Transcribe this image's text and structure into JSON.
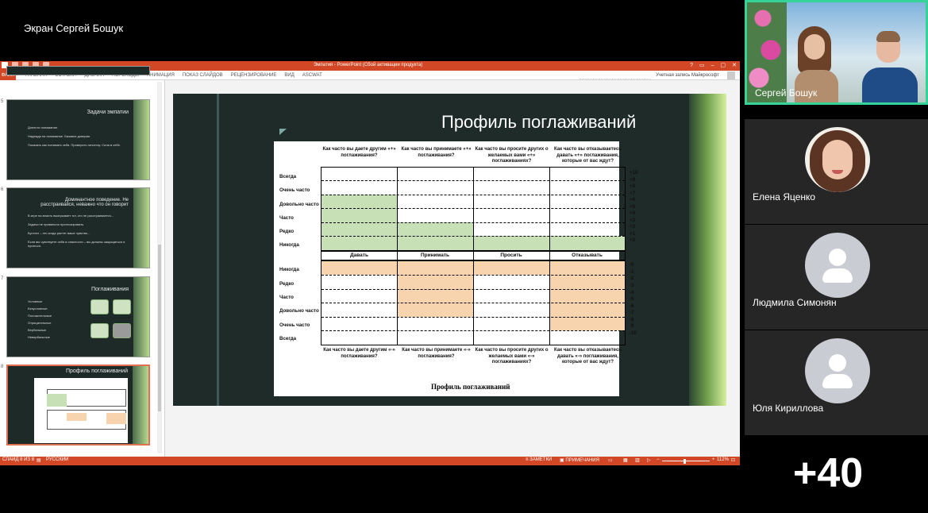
{
  "share_label": "Экран Сергей Бошук",
  "ppt": {
    "title": "Эмпатия - PowerPoint (Сбой активации продукта)",
    "file_tab": "ФАЙЛ",
    "tabs": [
      "ГЛАВНАЯ",
      "ВСТАВКА",
      "ДИЗАЙН",
      "ПЕРЕХОДЫ",
      "АНИМАЦИЯ",
      "ПОКАЗ СЛАЙДОВ",
      "РЕЦЕНЗИРОВАНИЕ",
      "ВИД",
      "ASCWAT"
    ],
    "account": "Учетная запись Майкрософт",
    "thumbs": [
      {
        "num": "5",
        "title": "Задачи эмпатии",
        "lines": [
          "Донести понимание.",
          "Надежда на понимание. Базовое доверие.",
          "Показать как понимать себя. Проверить гипотезу. Сила в себе."
        ]
      },
      {
        "num": "6",
        "title": "Доминантное поведение. Не расстраивайся, неважно что он говорит",
        "lines": [
          "В игре на власть выигрывает тот, кто не расстраивается...",
          "Задачи не правильно прогнозировать.",
          "Бустинг – это когда растет ваше чувство...",
          "Если вы чувствуете себя в опасности – вы должны защищаться и пугаться."
        ]
      },
      {
        "num": "7",
        "title": "Поглаживания",
        "lines": [
          "Условные",
          "Безусловные",
          "Положительные",
          "Отрицательные",
          "Вербальные",
          "Невербальные"
        ]
      },
      {
        "num": "8",
        "title": "Профиль поглаживаний",
        "lines": []
      }
    ],
    "slide": {
      "title": "Профиль поглаживаний",
      "questions_top": [
        "Как часто вы даете другим «+» поглаживания?",
        "Как часто вы принимаете «+» поглаживания?",
        "Как часто вы просите других о желаемых вами «+» поглаживаниях?",
        "Как часто вы отказываетесь давать «+» поглаживания, которые от вас ждут?"
      ],
      "questions_bottom": [
        "Как часто вы даете другим «-» поглаживания?",
        "Как часто вы принимаете «-» поглаживания?",
        "Как часто вы просите других о желаемых вами «-» поглаживаниях?",
        "Как часто вы отказываетесь давать «-» поглаживания, которые от вас ждут?"
      ],
      "rows_top": [
        "Всегда",
        "Очень часто",
        "Довольно часто",
        "Часто",
        "Редко",
        "Никогда"
      ],
      "rows_bottom": [
        "Никогда",
        "Редко",
        "Часто",
        "Довольно часто",
        "Очень часто",
        "Всегда"
      ],
      "columns": [
        "Давать",
        "Принимать",
        "Просить",
        "Отказывать"
      ],
      "scale_top": [
        "+10",
        "+9",
        "+8",
        "+7",
        "+6",
        "+5",
        "+4",
        "+3",
        "+2",
        "+1",
        "+0"
      ],
      "scale_bottom": [
        "-0",
        "-1",
        "-2",
        "-3",
        "-4",
        "-5",
        "-6",
        "-7",
        "-8",
        "-9",
        "-10"
      ],
      "footer": "Профиль поглаживаний"
    },
    "status": {
      "slide": "СЛАЙД 8 ИЗ 8",
      "lang": "РУССКИЙ",
      "notes": "ЗАМЕТКИ",
      "comments": "ПРИМЕЧАНИЯ",
      "zoom": "112%"
    }
  },
  "participants": [
    {
      "name": "Сергей Бошук"
    },
    {
      "name": "Елена Яценко"
    },
    {
      "name": "Людмила Симонян"
    },
    {
      "name": "Юля Кириллова"
    }
  ],
  "more_count": "+40"
}
